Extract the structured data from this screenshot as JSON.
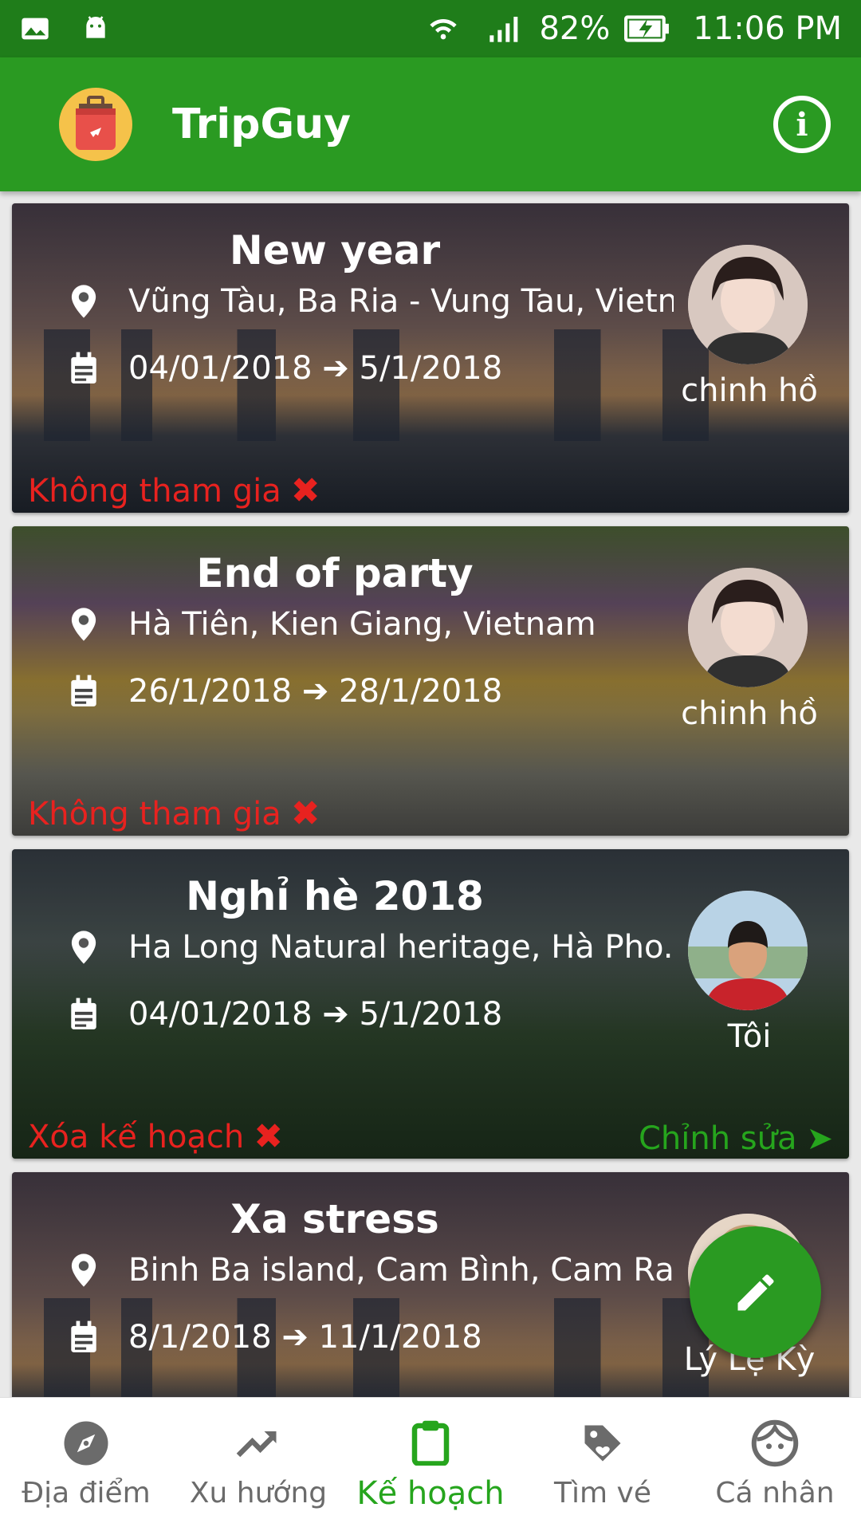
{
  "status_bar": {
    "battery": "82%",
    "time": "11:06 PM"
  },
  "app": {
    "title": "TripGuy"
  },
  "trips": [
    {
      "title": "New year",
      "location": "Vũng Tàu, Ba Ria - Vung Tau, Vietn...",
      "dates": "04/01/2018 ➔ 5/1/2018",
      "owner": "chinh hồ",
      "left_action": "Không tham gia",
      "right_action": ""
    },
    {
      "title": "End of party",
      "location": "Hà Tiên, Kien Giang, Vietnam",
      "dates": "26/1/2018 ➔ 28/1/2018",
      "owner": "chinh hồ",
      "left_action": "Không tham gia",
      "right_action": ""
    },
    {
      "title": "Nghỉ hè 2018",
      "location": "Ha Long Natural heritage, Hà Pho...",
      "dates": "04/01/2018 ➔ 5/1/2018",
      "owner": "Tôi",
      "left_action": "Xóa kế hoạch",
      "right_action": "Chỉnh sửa"
    },
    {
      "title": "Xa stress",
      "location": "Binh Ba island, Cam Bình, Cam Ra...",
      "dates": "8/1/2018 ➔ 11/1/2018",
      "owner": "Lý Lệ Kỳ",
      "left_action": "",
      "right_action": ""
    }
  ],
  "bottom_nav": [
    {
      "label": "Địa điểm",
      "icon": "compass-icon",
      "active": false
    },
    {
      "label": "Xu hướng",
      "icon": "trending-up-icon",
      "active": false
    },
    {
      "label": "Kế hoạch",
      "icon": "clipboard-icon",
      "active": true
    },
    {
      "label": "Tìm vé",
      "icon": "tag-icon",
      "active": false
    },
    {
      "label": "Cá nhân",
      "icon": "face-icon",
      "active": false
    }
  ],
  "colors": {
    "primary": "#2a9a22",
    "status_bar": "#1f7d1a",
    "danger": "#e8221f",
    "accent_green": "#26a51d"
  }
}
